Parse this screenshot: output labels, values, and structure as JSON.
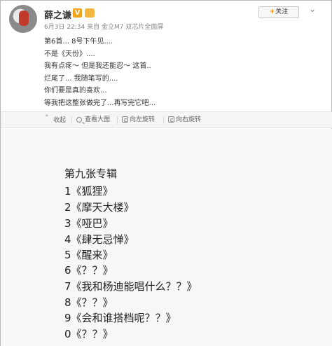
{
  "header": {
    "username": "薛之谦",
    "verified_icon": "verified-badge-icon",
    "verified_text": "V",
    "member_icon": "crown-icon",
    "member_text": "👑",
    "meta": "6月3日 22:34 来自 金立M7 双芯片全面屏",
    "follow_plus": "+",
    "follow_label": "关注",
    "more_icon": "chevron-down-icon"
  },
  "post": {
    "lines": [
      "第6首... 8号下午见....",
      "不是《天份》....",
      "我有点疼～ 但是我还能忍～ 这首..",
      "烂尾了... 我随笔写的....",
      "你们要是真的喜欢...",
      "等我把这整张做完了...再写完它吧..."
    ]
  },
  "toolbar": {
    "collapse": "收起",
    "zoom": "查看大图",
    "rotate_left": "向左旋转",
    "rotate_right": "向右旋转"
  },
  "photo": {
    "title": "第九张专辑",
    "tracks": [
      "1《狐狸》",
      "2《摩天大楼》",
      "3《哑巴》",
      "4《肆无忌惮》",
      "5《醒来》",
      "6《？？》",
      "7《我和杨迪能唱什么？？》",
      "8《？？》",
      "9《会和谁搭档呢？？》",
      "0《？？》"
    ]
  },
  "colors": {
    "accent": "#ff8200",
    "text": "#333333",
    "meta": "#888888",
    "toolbar_bg": "#f5f5f5",
    "photo_bg": "#f7f7f7"
  }
}
